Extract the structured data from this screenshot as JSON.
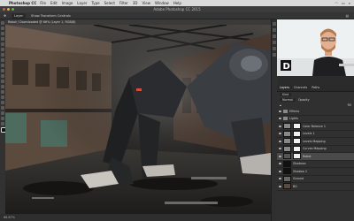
{
  "menubar": {
    "app": "Photoshop CC",
    "items": [
      "File",
      "Edit",
      "Image",
      "Layer",
      "Type",
      "Select",
      "Filter",
      "3D",
      "View",
      "Window",
      "Help"
    ]
  },
  "window": {
    "title": "Adobe Photoshop CC 2015"
  },
  "options_bar": {
    "items": [
      "Layer",
      "Show Transform Controls"
    ]
  },
  "document": {
    "tab": "Robot / Downloaded @ 66% (Layer 1, RGB/8)",
    "status": "66.67%"
  },
  "layers_panel": {
    "tabs": [
      "Layers",
      "Channels",
      "Paths"
    ],
    "search_placeholder": "Kind",
    "blend_mode": "Normal",
    "opacity_label": "Opacity",
    "fill_label": "Fill",
    "layers": [
      {
        "name": "Effects",
        "type": "folder"
      },
      {
        "name": "Lights",
        "type": "folder"
      },
      {
        "name": "Color Balance 1",
        "type": "adjustment"
      },
      {
        "name": "Levels 1",
        "type": "adjustment"
      },
      {
        "name": "Levels Mapping",
        "type": "adjustment"
      },
      {
        "name": "Curves Mapping",
        "type": "adjustment"
      },
      {
        "name": "Robot",
        "type": "layer"
      },
      {
        "name": "Shadows",
        "type": "layer"
      },
      {
        "name": "Shadow 2",
        "type": "layer"
      },
      {
        "name": "Ground",
        "type": "layer"
      },
      {
        "name": "BG",
        "type": "layer"
      }
    ]
  },
  "colors": {
    "ui_dark": "#2b2b2b",
    "panel": "#303030",
    "menubar": "#d9d9d9",
    "webcam_bg": "#eef1f2",
    "shirt": "#1f1f22"
  }
}
